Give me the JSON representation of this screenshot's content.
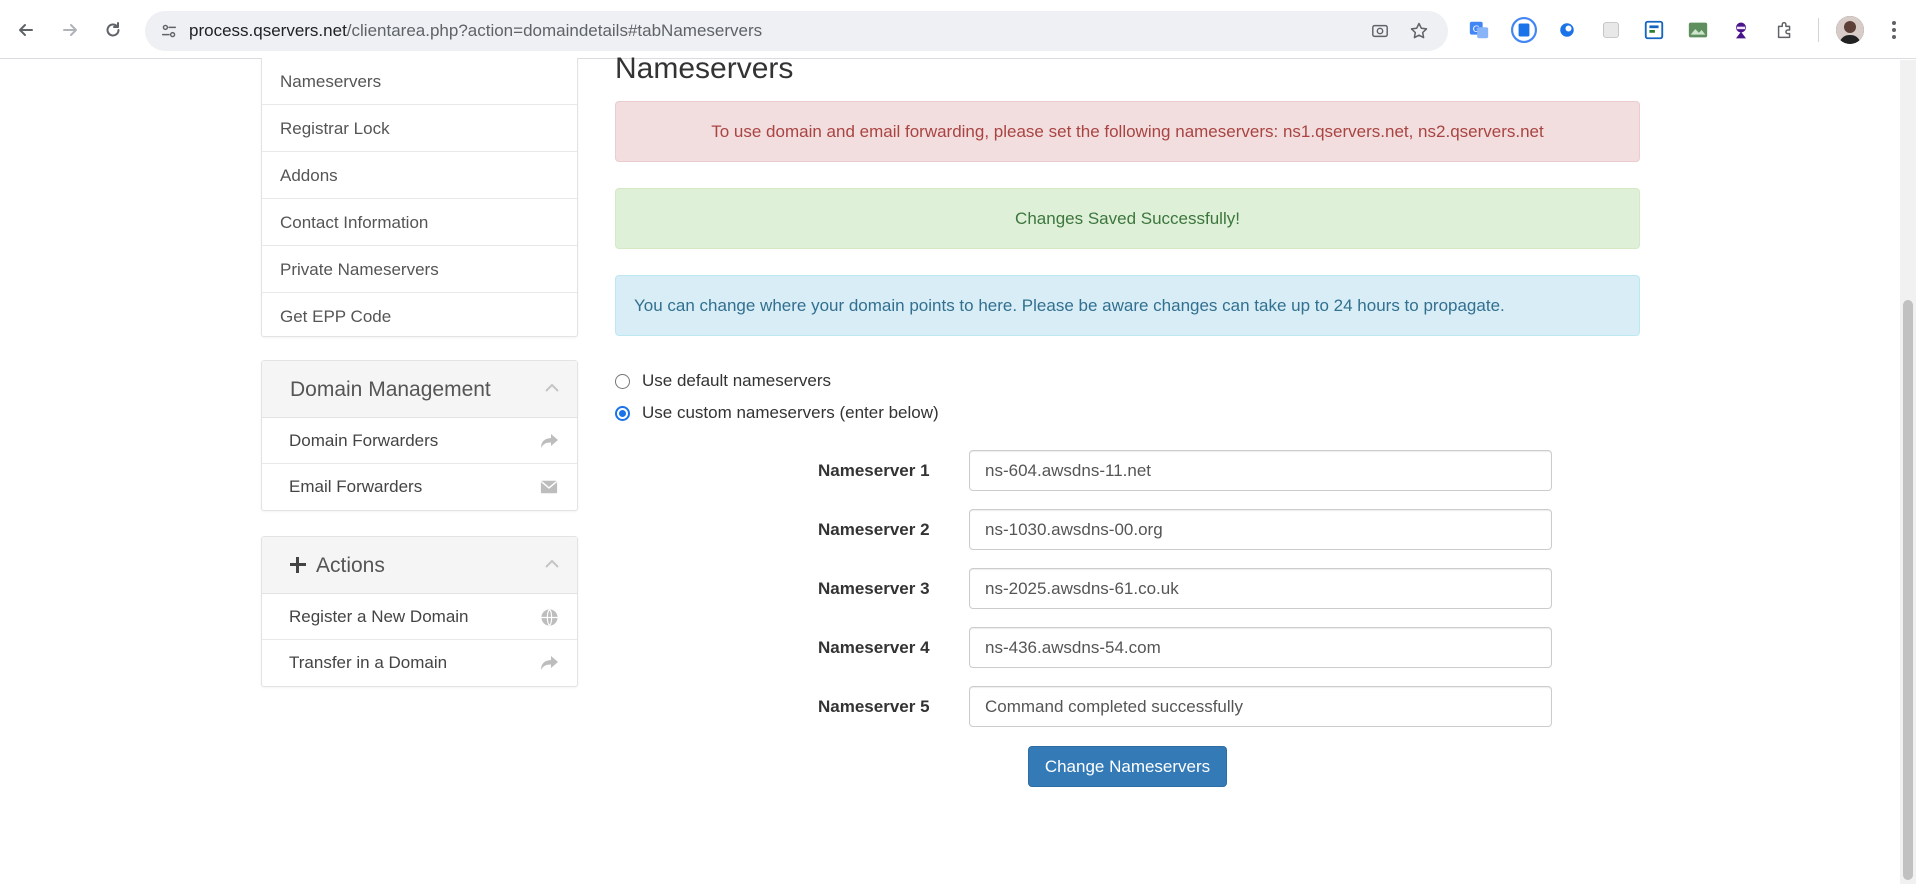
{
  "browser": {
    "url_host": "process.qservers.net",
    "url_path": "/clientarea.php?action=domaindetails#tabNameservers"
  },
  "sidebar": {
    "items": [
      {
        "label": "Nameservers"
      },
      {
        "label": "Registrar Lock"
      },
      {
        "label": "Addons"
      },
      {
        "label": "Contact Information"
      },
      {
        "label": "Private Nameservers"
      },
      {
        "label": "Get EPP Code"
      }
    ],
    "domain_management": {
      "title": "Domain Management",
      "items": [
        {
          "label": "Domain Forwarders",
          "icon": "share-icon"
        },
        {
          "label": "Email Forwarders",
          "icon": "envelope-icon"
        }
      ]
    },
    "actions": {
      "title": "Actions",
      "items": [
        {
          "label": "Register a New Domain",
          "icon": "globe-icon"
        },
        {
          "label": "Transfer in a Domain",
          "icon": "share-icon"
        }
      ]
    }
  },
  "main": {
    "title": "Nameservers",
    "alert_danger": "To use domain and email forwarding, please set the following nameservers: ns1.qservers.net, ns2.qservers.net",
    "alert_success": "Changes Saved Successfully!",
    "alert_info": "You can change where your domain points to here. Please be aware changes can take up to 24 hours to propagate.",
    "radio_default": "Use default nameservers",
    "radio_custom": "Use custom nameservers (enter below)",
    "nameservers": [
      {
        "label": "Nameserver 1",
        "value": "ns-604.awsdns-11.net"
      },
      {
        "label": "Nameserver 2",
        "value": "ns-1030.awsdns-00.org"
      },
      {
        "label": "Nameserver 3",
        "value": "ns-2025.awsdns-61.co.uk"
      },
      {
        "label": "Nameserver 4",
        "value": "ns-436.awsdns-54.com"
      },
      {
        "label": "Nameserver 5",
        "value": "Command completed successfully"
      }
    ],
    "submit_label": "Change Nameservers"
  },
  "colors": {
    "primary": "#337ab7",
    "danger_bg": "#f2dede",
    "success_bg": "#dff0d8",
    "info_bg": "#d9edf7"
  }
}
